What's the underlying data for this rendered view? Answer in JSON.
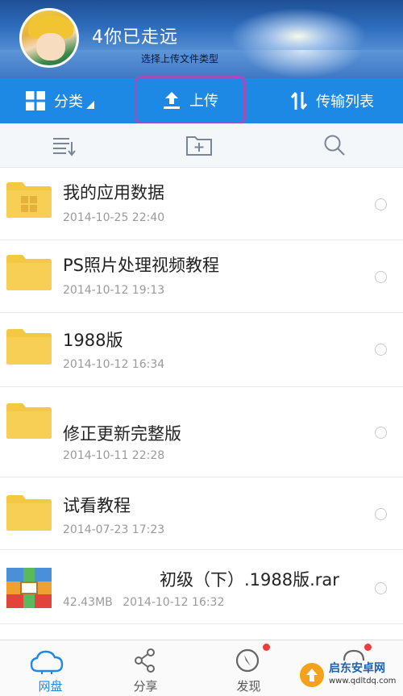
{
  "header": {
    "username": "4你已走远",
    "subtitle": "选择上传文件类型"
  },
  "actions": {
    "classify_label": "分类",
    "upload_label": "上传",
    "transfer_label": "传输列表",
    "highlight_color": "#a04fb8"
  },
  "toolbar": {
    "icons": [
      "sort-icon",
      "new-folder-icon",
      "search-icon"
    ]
  },
  "files": [
    {
      "name": "我的应用数据",
      "date": "2014-10-25 22:40",
      "icon": "app-folder-icon"
    },
    {
      "name": "PS照片处理视频教程",
      "date": "2014-10-12 19:13",
      "icon": "folder-icon"
    },
    {
      "name": "1988版",
      "date": "2014-10-12 16:34",
      "icon": "folder-icon"
    },
    {
      "name": "修正更新完整版",
      "date": "2014-10-11 22:28",
      "icon": "folder-icon"
    },
    {
      "name": "试看教程",
      "date": "2014-07-23 17:23",
      "icon": "folder-icon"
    },
    {
      "name": "初级（下）.1988版.rar",
      "size": "42.43MB",
      "date": "2014-10-12 16:32",
      "icon": "archive-icon"
    }
  ],
  "nav": [
    {
      "label": "网盘",
      "icon": "cloud-icon",
      "active": true
    },
    {
      "label": "分享",
      "icon": "share-icon",
      "active": false
    },
    {
      "label": "发现",
      "icon": "compass-icon",
      "active": false,
      "badge": true
    },
    {
      "label": "",
      "icon": "more-icon",
      "active": false,
      "badge": true
    }
  ],
  "watermark": {
    "title": "启东安卓网",
    "url": "www.qdltdq.com"
  },
  "colors": {
    "accent": "#1e88e5",
    "folder": "#f5c843",
    "badge": "#ee3b3b"
  }
}
